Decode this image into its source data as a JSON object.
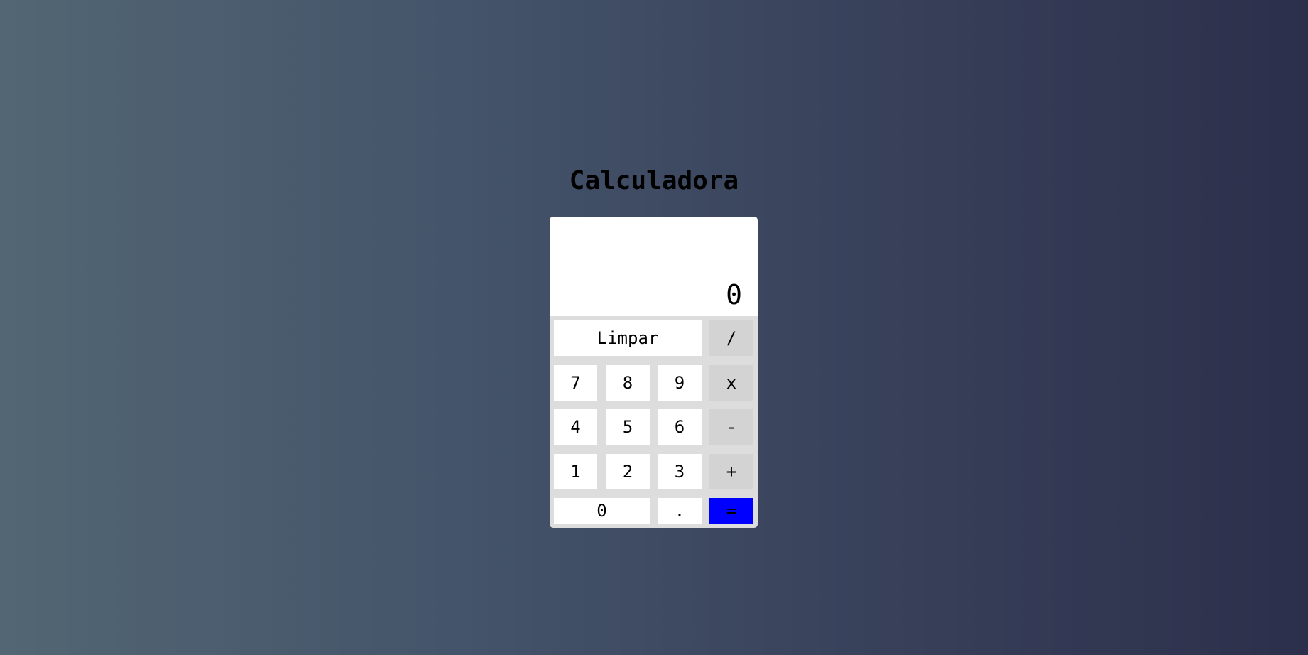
{
  "page": {
    "title": "Calculadora"
  },
  "display": {
    "value": "0"
  },
  "buttons": {
    "clear": "Limpar",
    "divide": "/",
    "seven": "7",
    "eight": "8",
    "nine": "9",
    "multiply": "x",
    "four": "4",
    "five": "5",
    "six": "6",
    "subtract": "-",
    "one": "1",
    "two": "2",
    "three": "3",
    "add": "+",
    "zero": "0",
    "decimal": ".",
    "equals": "="
  },
  "colors": {
    "equals_button": "#0000ff",
    "operator_button": "#d3d3d3",
    "digit_button": "#ffffff",
    "keypad_background": "#dddddd"
  }
}
